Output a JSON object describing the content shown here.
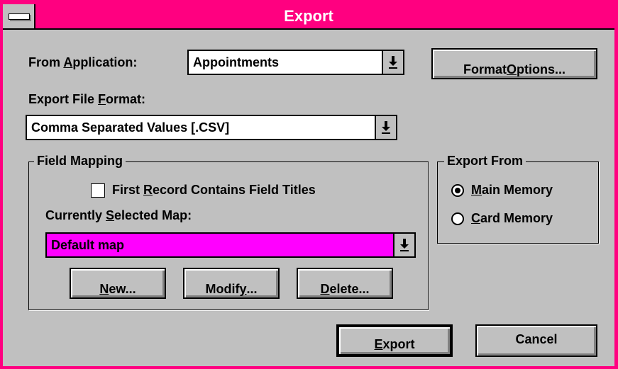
{
  "window": {
    "title": "Export"
  },
  "from_application": {
    "label_pre": "From ",
    "label_ul": "A",
    "label_post": "pplication:",
    "value": "Appointments"
  },
  "format_options_button": {
    "pre": "Format ",
    "ul": "O",
    "post": "ptions..."
  },
  "export_file_format": {
    "label_pre": "Export File ",
    "label_ul": "F",
    "label_post": "ormat:",
    "value": "Comma Separated Values [.CSV]"
  },
  "field_mapping": {
    "legend": "Field Mapping",
    "checkbox": {
      "pre": "First ",
      "ul": "R",
      "post": "ecord Contains Field Titles",
      "checked": false
    },
    "map_label": {
      "pre": "Currently ",
      "ul": "S",
      "post": "elected Map:"
    },
    "map_value": "Default map",
    "new_button": {
      "ul": "N",
      "post": "ew..."
    },
    "modify_button": {
      "pre": "Modif",
      "ul": "y",
      "post": "..."
    },
    "delete_button": {
      "ul": "D",
      "post": "elete..."
    }
  },
  "export_from": {
    "legend": "Export From",
    "options": [
      {
        "ul": "M",
        "post": "ain Memory",
        "selected": true
      },
      {
        "ul": "C",
        "post": "ard Memory",
        "selected": false
      }
    ]
  },
  "export_button": {
    "ul": "E",
    "post": "xport"
  },
  "cancel_button": {
    "label": "Cancel"
  },
  "colors": {
    "title_bar": "#ff0080",
    "face": "#c0c0c0",
    "selection": "#ff00ff"
  }
}
